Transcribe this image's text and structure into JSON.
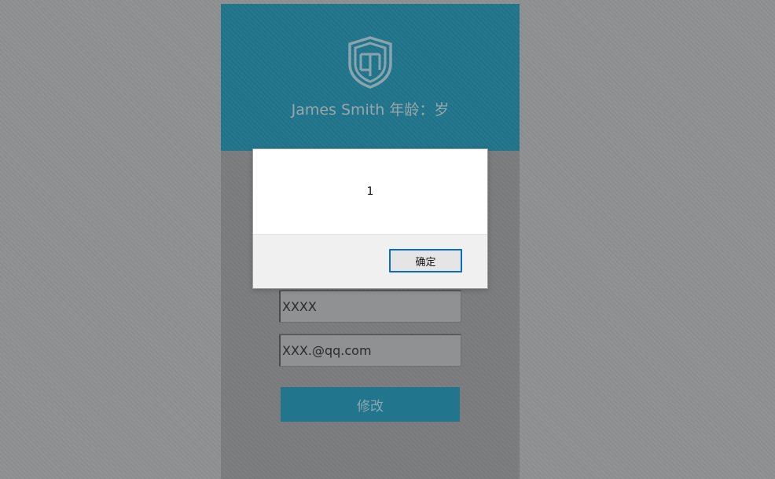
{
  "header": {
    "logo_icon": "shield-icon",
    "user_name": "James Smith 年龄：岁"
  },
  "form": {
    "name_value": "XXXX",
    "email_value": "XXX.@qq.com",
    "submit_label": "修改"
  },
  "dialog": {
    "message": "1",
    "ok_label": "确定"
  },
  "colors": {
    "accent": "#21758c",
    "overlay": "#8f9091",
    "dialog_button_border": "#0a6cc4"
  }
}
